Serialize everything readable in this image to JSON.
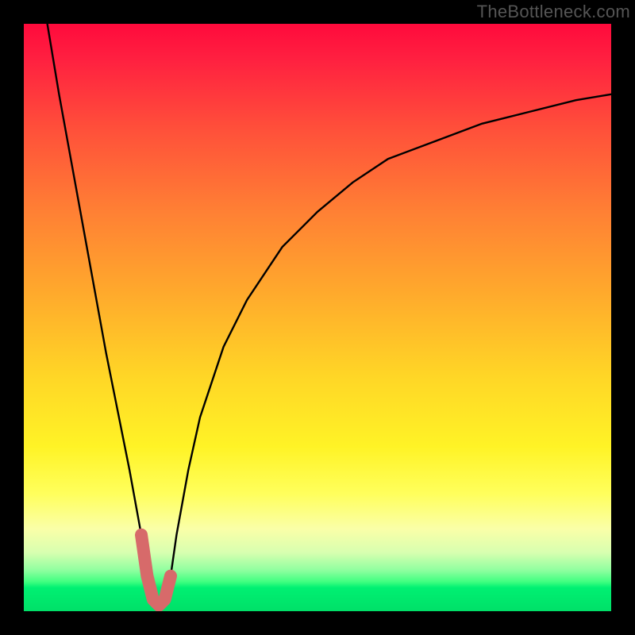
{
  "watermark": "TheBottleneck.com",
  "chart_data": {
    "type": "line",
    "title": "",
    "xlabel": "",
    "ylabel": "",
    "xlim": [
      0,
      100
    ],
    "ylim": [
      0,
      100
    ],
    "series": [
      {
        "name": "bottleneck-curve",
        "x": [
          4,
          6,
          8,
          10,
          12,
          14,
          16,
          18,
          20,
          21,
          22,
          23,
          24,
          25,
          26,
          28,
          30,
          34,
          38,
          44,
          50,
          56,
          62,
          70,
          78,
          86,
          94,
          100
        ],
        "values": [
          100,
          88,
          77,
          66,
          55,
          44,
          34,
          24,
          13,
          6,
          2,
          1,
          2,
          6,
          13,
          24,
          33,
          45,
          53,
          62,
          68,
          73,
          77,
          80,
          83,
          85,
          87,
          88
        ]
      }
    ],
    "annotations": [
      {
        "name": "minimum-band",
        "x_range": [
          20,
          25
        ],
        "color": "#d76a6a"
      }
    ],
    "colors": {
      "curve": "#000000",
      "highlight": "#d76a6a",
      "background_top": "#ff0a3c",
      "background_mid": "#ffd626",
      "background_bottom": "#00e068",
      "frame": "#000000"
    }
  }
}
